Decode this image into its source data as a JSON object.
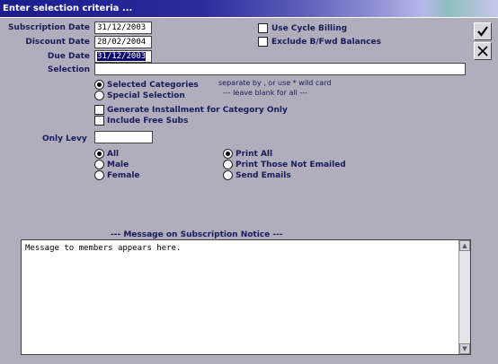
{
  "window": {
    "title": "Enter selection criteria ..."
  },
  "form": {
    "subscription_date": {
      "label": "Subscription Date",
      "value": "31/12/2003"
    },
    "discount_date": {
      "label": "Discount Date",
      "value": "28/02/2004"
    },
    "due_date": {
      "label": "Due Date",
      "value": "31/12/2003"
    },
    "selection": {
      "label": "Selection",
      "value": ""
    },
    "only_levy": {
      "label": "Only Levy",
      "value": ""
    }
  },
  "checks": {
    "use_cycle_billing": {
      "label": "Use Cycle Billing",
      "checked": false
    },
    "exclude_bfwd": {
      "label": "Exclude B/Fwd Balances",
      "checked": false
    },
    "generate_installment": {
      "label": "Generate Installment for Category Only",
      "checked": false
    },
    "include_free_subs": {
      "label": "Include Free Subs",
      "checked": false
    }
  },
  "selection_mode": {
    "selected_categories": "Selected Categories",
    "special_selection": "Special Selection",
    "selected": "selected_categories"
  },
  "hints": {
    "line1": "separate by , or use * wild card",
    "line2": "---  leave blank for all  ---"
  },
  "gender": {
    "all": "All",
    "male": "Male",
    "female": "Female",
    "selected": "all"
  },
  "print": {
    "print_all": "Print All",
    "print_not_emailed": "Print Those Not Emailed",
    "send_emails": "Send Emails",
    "selected": "print_all"
  },
  "message": {
    "heading": "---  Message on Subscription Notice  ---",
    "text": "Message to members appears here."
  },
  "icons": {
    "ok": "checkmark-icon",
    "cancel": "close-icon"
  },
  "colors": {
    "background": "#b0aebc",
    "title_bar": "#1c1c8e",
    "label": "#1a1a5a"
  }
}
